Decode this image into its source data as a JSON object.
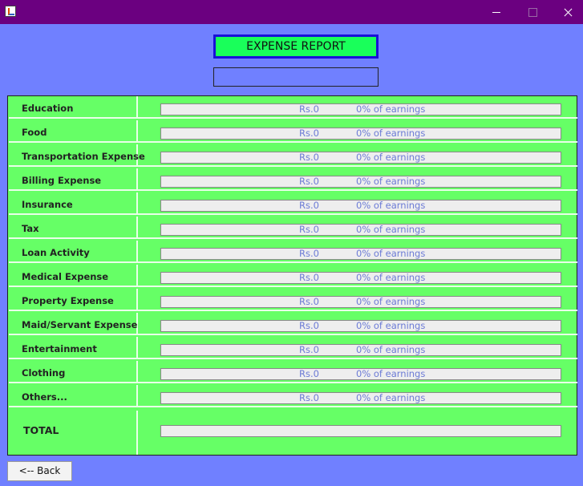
{
  "window": {
    "icons": [
      "java-icon",
      "minimize-icon",
      "maximize-icon",
      "close-icon"
    ]
  },
  "header": {
    "title": "EXPENSE REPORT",
    "subtitle_value": ""
  },
  "rows": [
    {
      "label": "Education",
      "amount": "Rs.0",
      "percent": "0% of earnings"
    },
    {
      "label": "Food",
      "amount": "Rs.0",
      "percent": "0% of earnings"
    },
    {
      "label": "Transportation Expense",
      "amount": "Rs.0",
      "percent": "0% of earnings"
    },
    {
      "label": "Billing Expense",
      "amount": "Rs.0",
      "percent": "0% of earnings"
    },
    {
      "label": "Insurance",
      "amount": "Rs.0",
      "percent": "0% of earnings"
    },
    {
      "label": "Tax",
      "amount": "Rs.0",
      "percent": "0% of earnings"
    },
    {
      "label": "Loan Activity",
      "amount": "Rs.0",
      "percent": "0% of earnings"
    },
    {
      "label": "Medical Expense",
      "amount": "Rs.0",
      "percent": "0% of earnings"
    },
    {
      "label": "Property Expense",
      "amount": "Rs.0",
      "percent": "0% of earnings"
    },
    {
      "label": "Maid/Servant Expense",
      "amount": "Rs.0",
      "percent": "0% of earnings"
    },
    {
      "label": "Entertainment",
      "amount": "Rs.0",
      "percent": "0% of earnings"
    },
    {
      "label": "Clothing",
      "amount": "Rs.0",
      "percent": "0% of earnings"
    },
    {
      "label": "Others...",
      "amount": "Rs.0",
      "percent": "0% of earnings"
    }
  ],
  "total": {
    "label": "TOTAL",
    "progress": 0
  },
  "back_button": {
    "label": "<-- Back"
  },
  "colors": {
    "background": "#7080ff",
    "titlebar": "#6b0080",
    "panel": "#66ff66",
    "title_box": "#19ff5a",
    "title_border": "#1a10d8",
    "bar_text": "#6c7bd6"
  }
}
